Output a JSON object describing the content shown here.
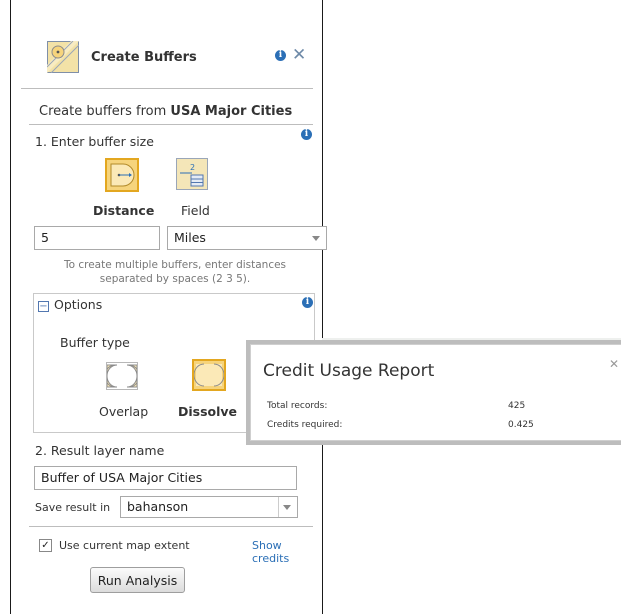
{
  "header": {
    "title": "Create Buffers",
    "icon": "buffer-tool-icon"
  },
  "subtitle": {
    "prefix": "Create buffers from ",
    "layer": "USA Major Cities"
  },
  "step1": {
    "label": "1. Enter buffer size",
    "modes": [
      {
        "label": "Distance",
        "icon": "distance-icon",
        "selected": true
      },
      {
        "label": "Field",
        "icon": "field-icon",
        "selected": false
      }
    ],
    "distance_value": "5",
    "unit_value": "Miles",
    "hint_line1": "To create multiple buffers, enter distances",
    "hint_line2": "separated by spaces (2 3 5)."
  },
  "options": {
    "label": "Options",
    "buffer_type_label": "Buffer type",
    "types": [
      {
        "label": "Overlap",
        "icon": "overlap-icon",
        "selected": false
      },
      {
        "label": "Dissolve",
        "icon": "dissolve-icon",
        "selected": true
      }
    ]
  },
  "step2": {
    "label": "2. Result layer name",
    "result_name": "Buffer of USA Major Cities",
    "save_label": "Save result in",
    "save_value": "bahanson"
  },
  "footer": {
    "extent_label": "Use current map extent",
    "extent_checked": true,
    "show_credits": "Show credits",
    "run_button": "Run Analysis"
  },
  "popup": {
    "title": "Credit Usage Report",
    "rows": [
      {
        "label": "Total records:",
        "value": "425"
      },
      {
        "label": "Credits required:",
        "value": "0.425"
      }
    ]
  },
  "colors": {
    "accent": "#2b6fb6",
    "selected_border": "#e3a720",
    "selected_fill": "#f6d47c"
  }
}
